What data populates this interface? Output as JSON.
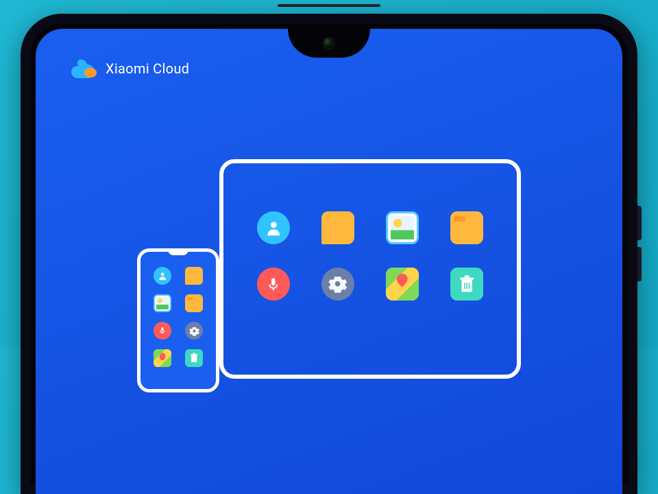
{
  "header": {
    "app_title": "Xiaomi Cloud"
  },
  "icons": {
    "contact": "contact-icon",
    "chat": "chat-icon",
    "photo": "photo-icon",
    "folder": "folder-icon",
    "mic": "microphone-icon",
    "gear": "settings-icon",
    "map": "maps-icon",
    "trash": "trash-icon"
  },
  "colors": {
    "background_start": "#1fb8d4",
    "background_end": "#15a8c5",
    "screen_primary": "#1a5ff0",
    "accent_orange": "#ff9a2a",
    "accent_yellow": "#ffb83d"
  }
}
